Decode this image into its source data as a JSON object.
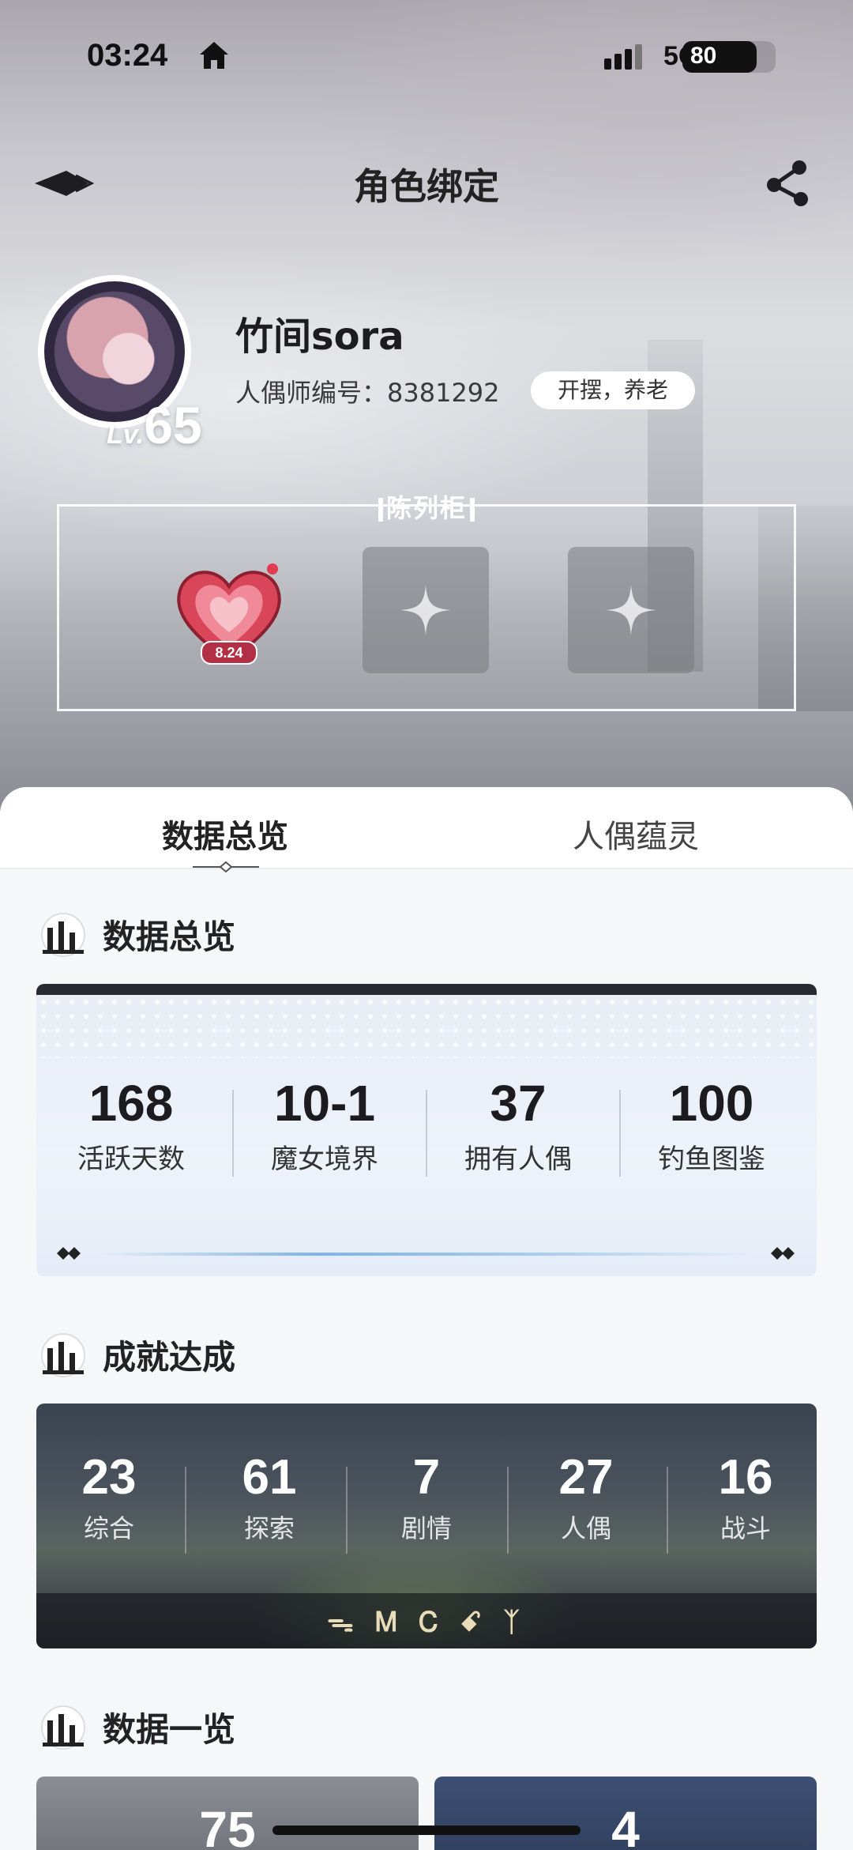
{
  "status_bar": {
    "time": "03:24",
    "network": "5G",
    "battery_level": "80",
    "battery_fraction": 0.8
  },
  "header": {
    "title": "角色绑定",
    "back_icon": "back-arrow-icon",
    "share_icon": "share-icon"
  },
  "profile": {
    "username": "竹间sora",
    "uid_label": "人偶师编号：",
    "uid": "8381292",
    "uid_text": "人偶师编号：8381292",
    "motto": "开摆，养老",
    "level_prefix": "Lv.",
    "level": "65"
  },
  "showcase": {
    "title": "陈列柜",
    "items": [
      {
        "type": "heart-badge",
        "label": "8.24"
      },
      {
        "type": "empty-slot"
      },
      {
        "type": "empty-slot"
      }
    ]
  },
  "tabs": [
    {
      "label": "数据总览",
      "active": true
    },
    {
      "label": "人偶蕴灵",
      "active": false
    }
  ],
  "overview": {
    "title": "数据总览",
    "stats": [
      {
        "value": "168",
        "label": "活跃天数"
      },
      {
        "value": "10-1",
        "label": "魔女境界"
      },
      {
        "value": "37",
        "label": "拥有人偶"
      },
      {
        "value": "100",
        "label": "钓鱼图鉴"
      }
    ]
  },
  "achievements": {
    "title": "成就达成",
    "items": [
      {
        "value": "23",
        "label": "综合"
      },
      {
        "value": "61",
        "label": "探索"
      },
      {
        "value": "7",
        "label": "剧情"
      },
      {
        "value": "27",
        "label": "人偶"
      },
      {
        "value": "16",
        "label": "战斗"
      }
    ],
    "rune": "ᯓ Ꮇ Ꮯ ꗃ ᛉ"
  },
  "data_list": {
    "title": "数据一览",
    "cards": [
      {
        "value": "75"
      },
      {
        "value": "4"
      }
    ]
  },
  "colors": {
    "accent_dark": "#2a2a33",
    "overview_bg": "#eef3fa",
    "panel_bg": "#f6f7f9"
  }
}
